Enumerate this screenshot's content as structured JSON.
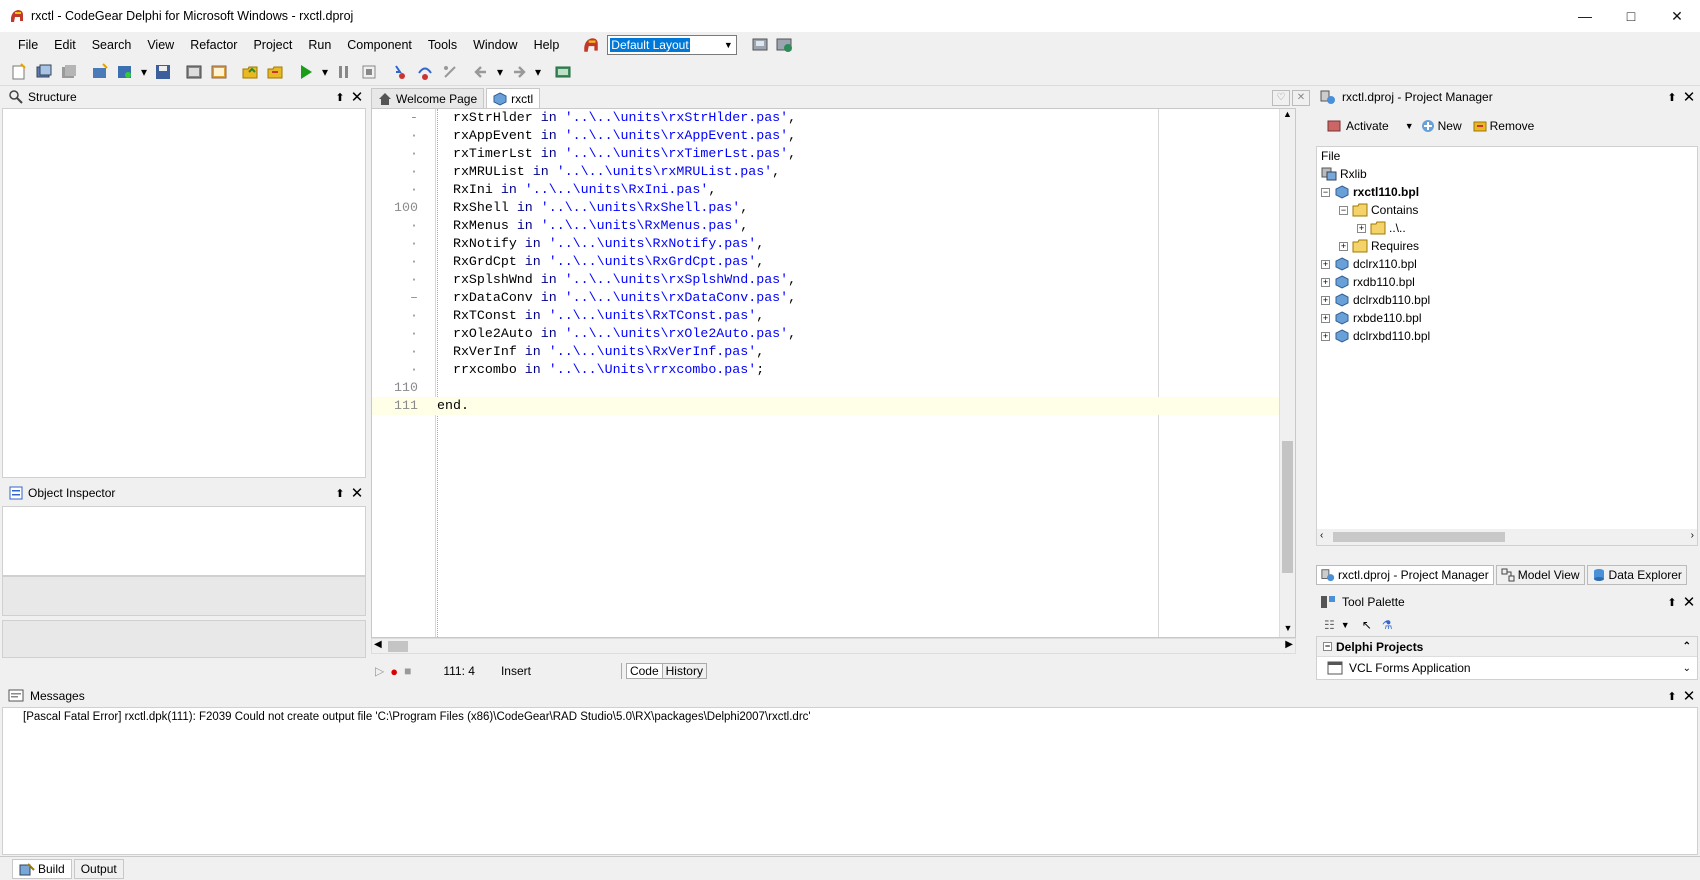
{
  "window": {
    "title": "rxctl - CodeGear Delphi for Microsoft Windows - rxctl.dproj"
  },
  "menu": [
    "File",
    "Edit",
    "Search",
    "View",
    "Refactor",
    "Project",
    "Run",
    "Component",
    "Tools",
    "Window",
    "Help"
  ],
  "layout_select": {
    "value": "Default Layout"
  },
  "structure": {
    "title": "Structure"
  },
  "object_inspector": {
    "title": "Object Inspector"
  },
  "editor": {
    "tabs": [
      "Welcome Page",
      "rxctl"
    ],
    "lines": [
      {
        "num": "-",
        "ident": "  rxStrHlder",
        "path": "'..\\..\\units\\rxStrHlder.pas'",
        "end": ","
      },
      {
        "num": "·",
        "ident": "  rxAppEvent",
        "path": "'..\\..\\units\\rxAppEvent.pas'",
        "end": ","
      },
      {
        "num": "·",
        "ident": "  rxTimerLst",
        "path": "'..\\..\\units\\rxTimerLst.pas'",
        "end": ","
      },
      {
        "num": "·",
        "ident": "  rxMRUList",
        "path": "'..\\..\\units\\rxMRUList.pas'",
        "end": ","
      },
      {
        "num": "·",
        "ident": "  RxIni",
        "path": "'..\\..\\units\\RxIni.pas'",
        "end": ","
      },
      {
        "num": "100",
        "ident": "  RxShell",
        "path": "'..\\..\\units\\RxShell.pas'",
        "end": ","
      },
      {
        "num": "·",
        "ident": "  RxMenus",
        "path": "'..\\..\\units\\RxMenus.pas'",
        "end": ","
      },
      {
        "num": "·",
        "ident": "  RxNotify",
        "path": "'..\\..\\units\\RxNotify.pas'",
        "end": ","
      },
      {
        "num": "·",
        "ident": "  RxGrdCpt",
        "path": "'..\\..\\units\\RxGrdCpt.pas'",
        "end": ","
      },
      {
        "num": "·",
        "ident": "  rxSplshWnd",
        "path": "'..\\..\\units\\rxSplshWnd.pas'",
        "end": ","
      },
      {
        "num": "–",
        "ident": "  rxDataConv",
        "path": "'..\\..\\units\\rxDataConv.pas'",
        "end": ","
      },
      {
        "num": "·",
        "ident": "  RxTConst",
        "path": "'..\\..\\units\\RxTConst.pas'",
        "end": ","
      },
      {
        "num": "·",
        "ident": "  rxOle2Auto",
        "path": "'..\\..\\units\\rxOle2Auto.pas'",
        "end": ","
      },
      {
        "num": "·",
        "ident": "  RxVerInf",
        "path": "'..\\..\\units\\RxVerInf.pas'",
        "end": ","
      },
      {
        "num": "·",
        "ident": "  rrxcombo",
        "path": "'..\\..\\Units\\rrxcombo.pas'",
        "end": ";"
      },
      {
        "num": "110",
        "ident": "",
        "path": "",
        "end": ""
      },
      {
        "num": "111",
        "ident": "end.",
        "path": "",
        "end": ""
      }
    ],
    "keyword_in": "in",
    "status": {
      "position": "111:  4",
      "mode": "Insert",
      "tab_code": "Code",
      "tab_history": "History"
    }
  },
  "project_manager": {
    "title": "rxctl.dproj - Project Manager",
    "buttons": {
      "activate": "Activate",
      "new": "New",
      "remove": "Remove"
    },
    "column": "File",
    "tree": {
      "root": "Rxlib",
      "active": "rxctl110.bpl",
      "contains": "Contains",
      "contains_child": "..\\..",
      "requires": "Requires",
      "others": [
        "dclrx110.bpl",
        "rxdb110.bpl",
        "dclrxdb110.bpl",
        "rxbde110.bpl",
        "dclrxbd110.bpl"
      ]
    },
    "tabs": [
      "rxctl.dproj - Project Manager",
      "Model View",
      "Data Explorer"
    ]
  },
  "tool_palette": {
    "title": "Tool Palette",
    "category": "Delphi Projects",
    "item": "VCL Forms Application"
  },
  "messages": {
    "title": "Messages",
    "line": "[Pascal Fatal Error] rxctl.dpk(111): F2039 Could not create output file 'C:\\Program Files (x86)\\CodeGear\\RAD Studio\\5.0\\RX\\packages\\Delphi2007\\rxctl.drc'",
    "tabs": [
      "Build",
      "Output"
    ]
  }
}
